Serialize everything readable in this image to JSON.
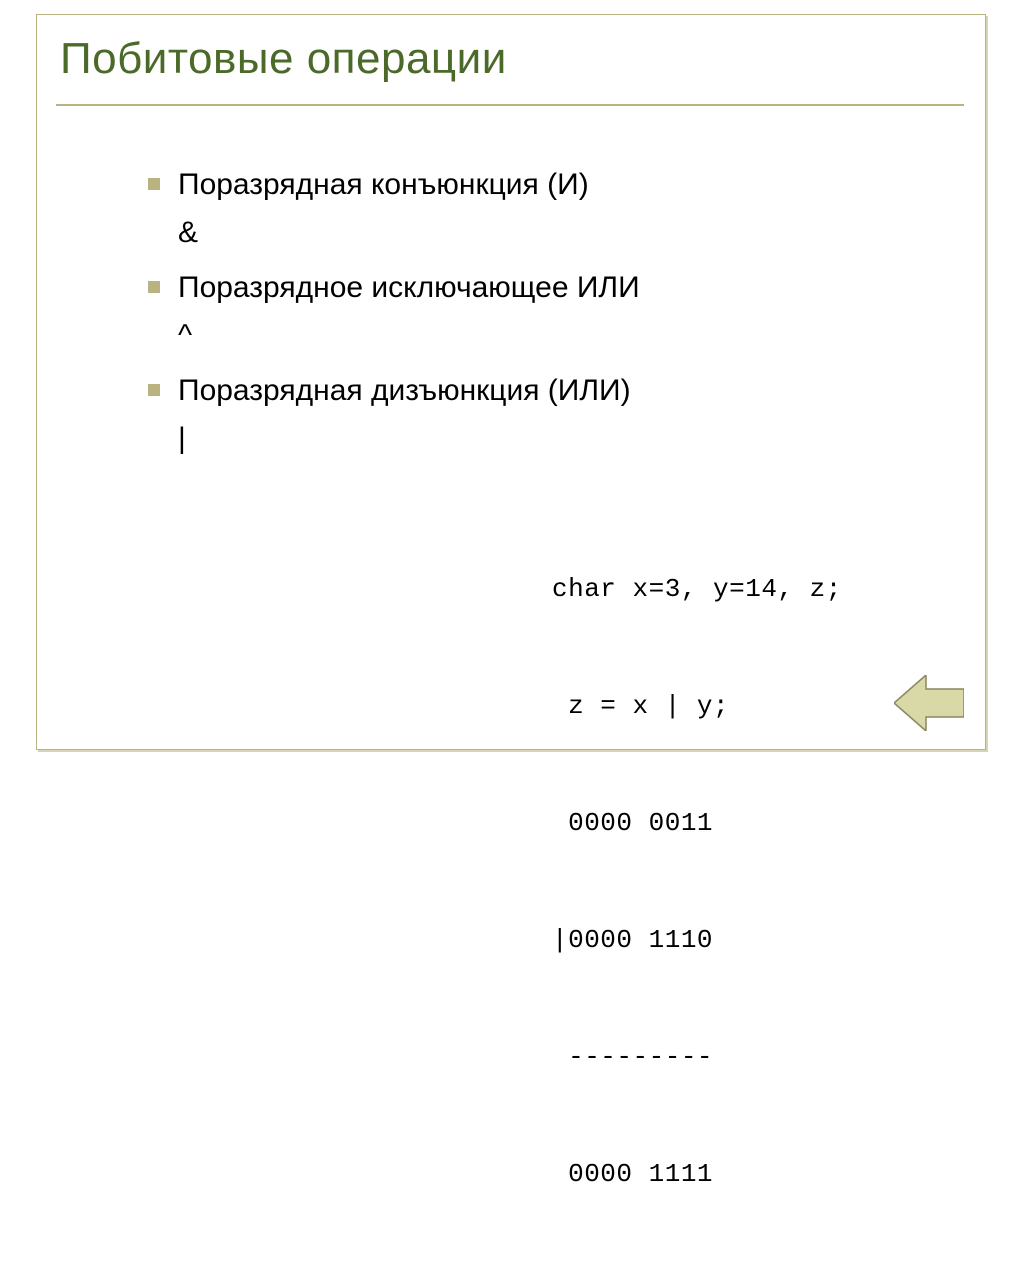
{
  "title": "Побитовые операции",
  "bullets": [
    {
      "label": "Поразрядная конъюнкция (И)",
      "op": "&"
    },
    {
      "label": "Поразрядное исключающее ИЛИ",
      "op": "^"
    },
    {
      "label": "Поразрядная дизъюнкция (ИЛИ)",
      "op": "|"
    }
  ],
  "code": {
    "decl": "char x=3, y=14, z;",
    "expr": " z = x | y;",
    "row1": " 0000 0011",
    "row2": "|0000 1110",
    "sep": " ---------",
    "result": " 0000 1111"
  }
}
